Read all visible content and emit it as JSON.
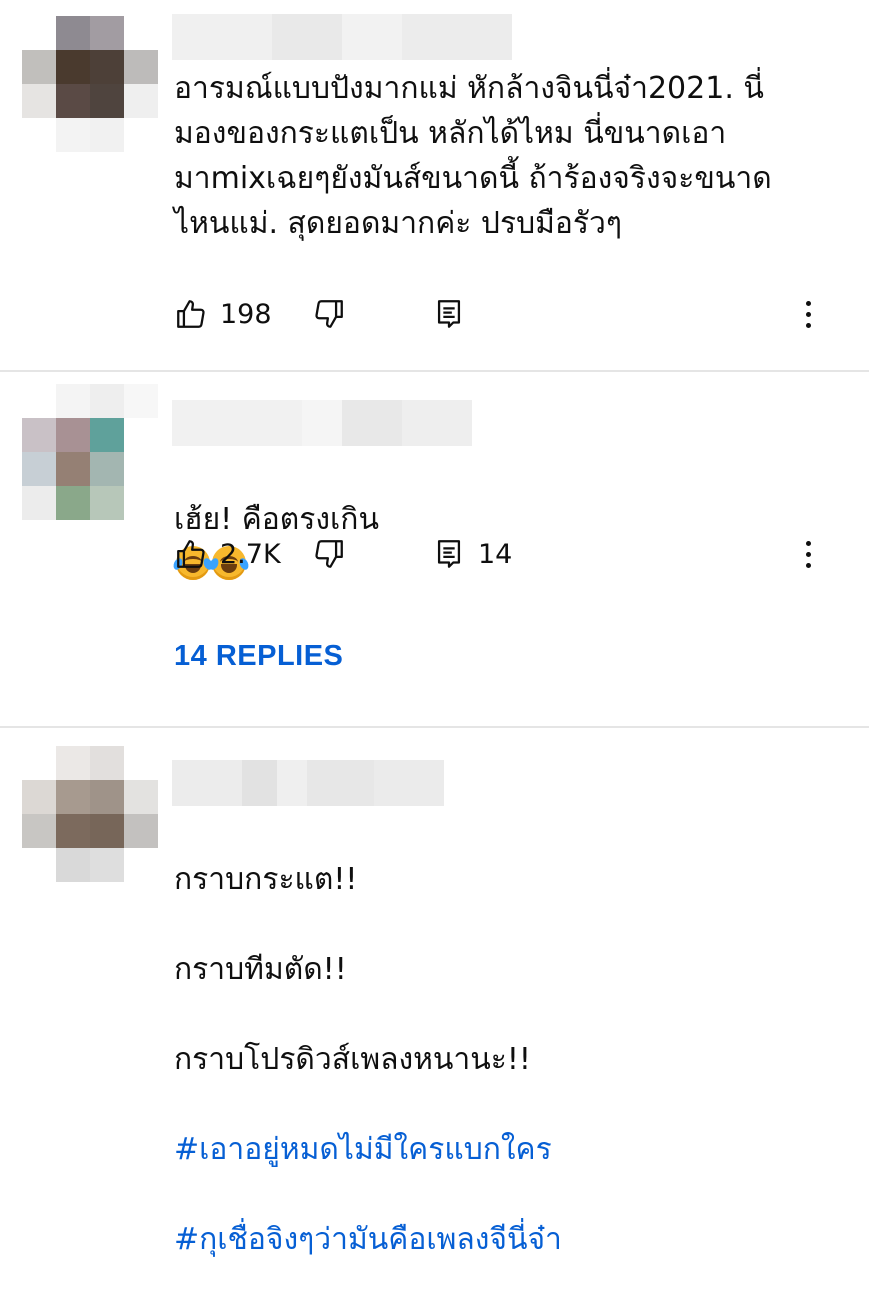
{
  "colors": {
    "link": "#065fd4",
    "divider": "#e5e5e5",
    "text": "#0f0f0f"
  },
  "comments": [
    {
      "text": "อารมณ์แบบปังมากแม่ หักล้างจินนี่จ๋า2021. นี่\nมองของกระแตเป็น หลักได้ไหม นี่ขนาดเอา\nมาmixเฉยๆยังมันส์ขนาดนี้  ถ้าร้องจริงจะขนาด\nไหนแม่. สุดยอดมากค่ะ ปรบมือรัวๆ",
      "likes": "198",
      "icons": {
        "like": "thumbs-up-icon",
        "dislike": "thumbs-down-icon",
        "reply": "comment-icon",
        "menu": "more-vert-icon"
      }
    },
    {
      "text": "เฮ้ย! คือตรงเกิน",
      "emoji": "rolling-on-floor-laughing-icon",
      "likes": "2.7K",
      "reply_count": "14",
      "replies_label": "14 REPLIES"
    },
    {
      "lines": [
        "กราบกระแต!!",
        "กราบทีมตัด!!",
        "กราบโปรดิวส์เพลงหนานะ!!"
      ],
      "hashtags": [
        "#เอาอยู่หมดไม่มีใครแบกใคร",
        "#กุเชื่อจิงๆว่ามันคือเพลงจีนี่จ๋า"
      ]
    }
  ]
}
